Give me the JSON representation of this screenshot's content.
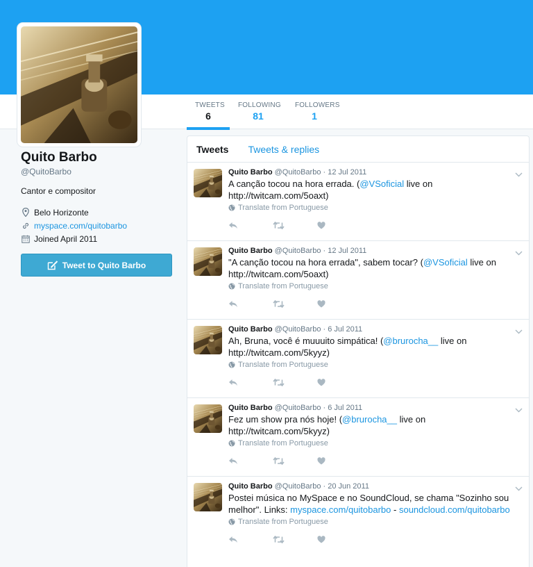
{
  "profile": {
    "name": "Quito Barbo",
    "handle": "@QuitoBarbo",
    "bio": "Cantor e compositor",
    "location": "Belo Horizonte",
    "website": "myspace.com/quitobarbo",
    "joined": "Joined April 2011",
    "tweet_button": "Tweet to Quito Barbo"
  },
  "stats": [
    {
      "label": "TWEETS",
      "value": "6"
    },
    {
      "label": "FOLLOWING",
      "value": "81"
    },
    {
      "label": "FOLLOWERS",
      "value": "1"
    }
  ],
  "tabs": {
    "tweets": "Tweets",
    "replies": "Tweets & replies"
  },
  "translate_label": "Translate from Portuguese",
  "tweets": [
    {
      "name": "Quito Barbo",
      "handle": "@QuitoBarbo",
      "date": "12 Jul 2011",
      "text_a": "A canção tocou na hora errada. (",
      "mention": "@VSoficial",
      "text_b": " live on http://twitcam.com/5oaxt)"
    },
    {
      "name": "Quito Barbo",
      "handle": "@QuitoBarbo",
      "date": "12 Jul 2011",
      "text_a": "\"A canção tocou na hora errada\", sabem tocar? (",
      "mention": "@VSoficial",
      "text_b": " live on http://twitcam.com/5oaxt)"
    },
    {
      "name": "Quito Barbo",
      "handle": "@QuitoBarbo",
      "date": "6 Jul 2011",
      "text_a": "Ah, Bruna, você é muuuito simpática! (",
      "mention": "@brurocha__",
      "text_b": " live on http://twitcam.com/5kyyz)"
    },
    {
      "name": "Quito Barbo",
      "handle": "@QuitoBarbo",
      "date": "6 Jul 2011",
      "text_a": "Fez um show pra nós hoje! (",
      "mention": "@brurocha__",
      "text_b": " live on http://twitcam.com/5kyyz)"
    },
    {
      "name": "Quito Barbo",
      "handle": "@QuitoBarbo",
      "date": "20 Jun 2011",
      "text_a": "Postei música no MySpace e no SoundCloud, se chama \"Sozinho sou melhor\". Links: ",
      "link1": "myspace.com/quitobarbo",
      "sep": " - ",
      "link2": "soundcloud.com/quitobarbo"
    }
  ],
  "colors": {
    "banner": "#1da1f2",
    "link": "#1b95e0",
    "button": "#3ea9d3"
  }
}
